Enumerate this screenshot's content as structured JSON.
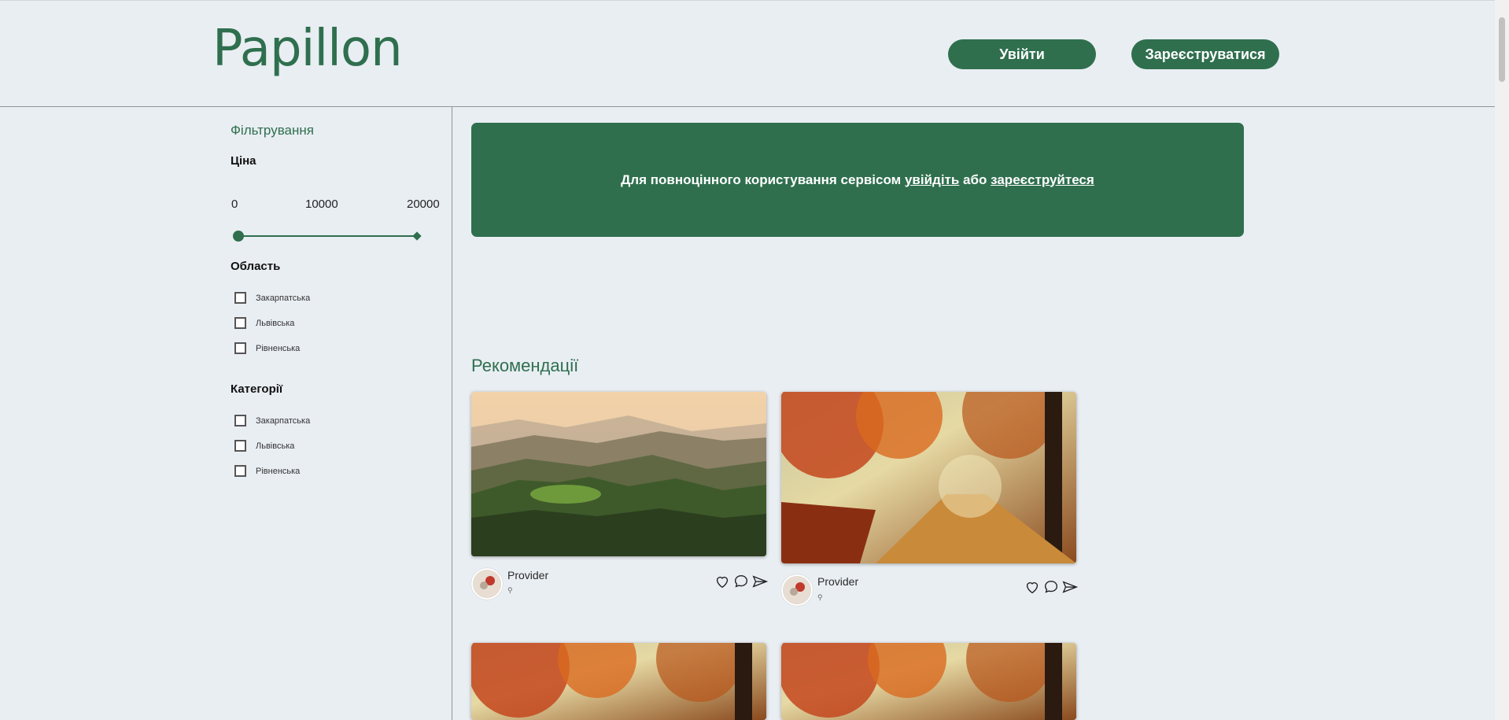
{
  "header": {
    "logo": "Papillon",
    "login_label": "Увійти",
    "register_label": "Зареєструватися"
  },
  "sidebar": {
    "filter_title": "Фільтрування",
    "price": {
      "title": "Ціна",
      "ticks": [
        "0",
        "10000",
        "20000"
      ],
      "range_min": 0,
      "range_max": 20000
    },
    "region": {
      "title": "Область",
      "options": [
        "Закарпатська",
        "Львівська",
        "Рівненська"
      ]
    },
    "category": {
      "title": "Категорії",
      "options": [
        "Закарпатська",
        "Львівська",
        "Рівненська"
      ]
    }
  },
  "banner": {
    "prefix": "Для повноцінного користування сервісом ",
    "login_link": "увійдіть",
    "middle": " або ",
    "register_link": "зареєструйтеся"
  },
  "recommendations": {
    "title": "Рекомендації",
    "cards": [
      {
        "provider": "Provider",
        "image": "mountain-landscape"
      },
      {
        "provider": "Provider",
        "image": "autumn-forest-path"
      },
      {
        "provider": "",
        "image": "autumn-forest-path"
      },
      {
        "provider": "",
        "image": "autumn-forest-path"
      }
    ]
  },
  "colors": {
    "accent": "#2f6f4e",
    "background": "#e9eef3"
  }
}
